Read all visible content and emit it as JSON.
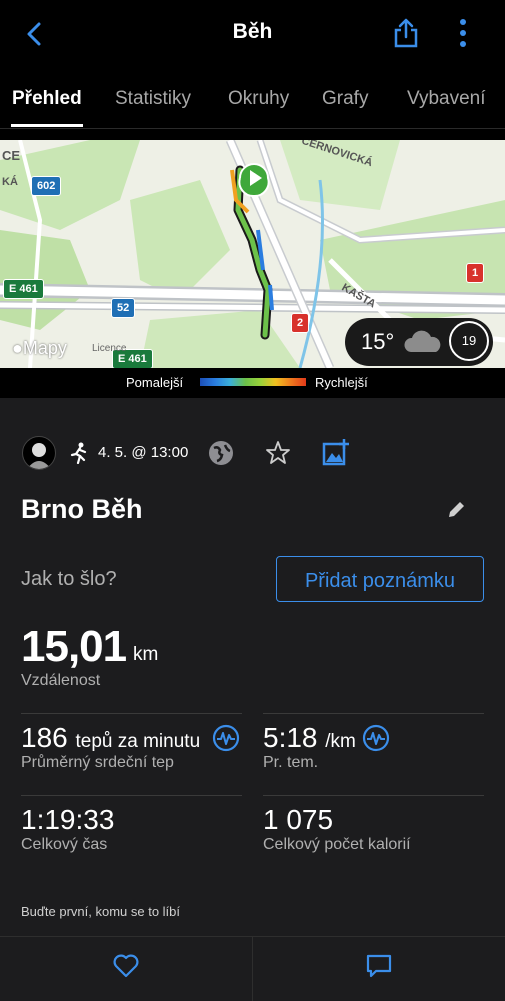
{
  "header": {
    "title": "Běh",
    "back_icon": "chevron-left-icon",
    "share_icon": "share-icon",
    "more_icon": "more-vertical-icon",
    "accent": "#3b8eea"
  },
  "tabs": [
    {
      "label": "Přehled"
    },
    {
      "label": "Statistiky"
    },
    {
      "label": "Okruhy"
    },
    {
      "label": "Grafy"
    },
    {
      "label": "Vybavení"
    }
  ],
  "map": {
    "labels": [
      "CE",
      "KÁ",
      "ČERNOVICKÁ",
      "KAŠTA"
    ],
    "badges": [
      "602",
      "E 461",
      "52",
      "1",
      "2",
      "E 461"
    ],
    "provider": "Mapy",
    "licence": "Licence",
    "weather": {
      "temp": "15°",
      "wind": "19"
    }
  },
  "legend": {
    "slow": "Pomalejší",
    "fast": "Rychlejší"
  },
  "activity": {
    "datetime": "4. 5. @ 13:00",
    "title": "Brno Běh",
    "how_prompt": "Jak to šlo?",
    "add_note": "Přidat poznámku",
    "distance": {
      "value": "15,01",
      "unit": "km",
      "label": "Vzdálenost"
    },
    "stats": [
      {
        "value": "186",
        "unit": "tepů za minutu",
        "label": "Průměrný srdeční tep"
      },
      {
        "value": "5:18",
        "unit": "/km",
        "label": "Pr. tem."
      },
      {
        "value": "1:19:33",
        "unit": "",
        "label": "Celkový čas"
      },
      {
        "value": "1 075",
        "unit": "",
        "label": "Celkový počet kalorií"
      }
    ],
    "like_prompt": "Buďte první, komu se to líbí"
  }
}
